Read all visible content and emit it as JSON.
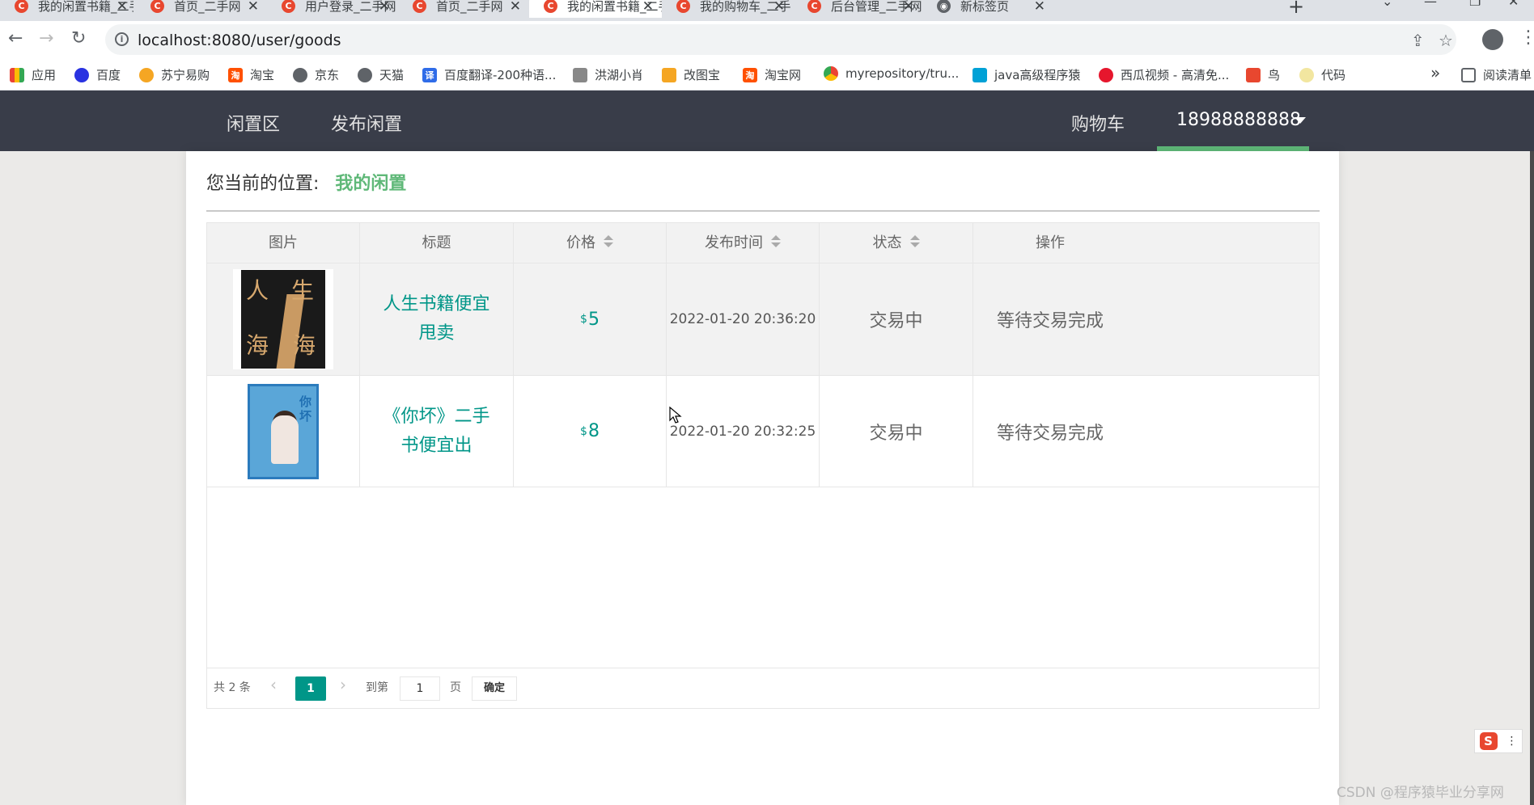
{
  "browser": {
    "tabs": [
      {
        "title": "我的闲置书籍_二手",
        "active": false
      },
      {
        "title": "首页_二手网",
        "active": false
      },
      {
        "title": "用户登录_二手网",
        "active": false
      },
      {
        "title": "首页_二手网",
        "active": false
      },
      {
        "title": "我的闲置书籍_二手",
        "active": true
      },
      {
        "title": "我的购物车_二手",
        "active": false
      },
      {
        "title": "后台管理_二手网",
        "active": false
      },
      {
        "title": "新标签页",
        "active": false
      }
    ],
    "url": "localhost:8080/user/goods",
    "bookmarks": [
      "应用",
      "百度",
      "苏宁易购",
      "淘宝",
      "京东",
      "天猫",
      "百度翻译-200种语...",
      "洪湖小肖",
      "改图宝",
      "淘宝网",
      "myrepository/tru...",
      "java高级程序猿",
      "西瓜视频 - 高清免...",
      "鸟",
      "代码"
    ],
    "reading_list": "阅读清单"
  },
  "nav": {
    "links": [
      "闲置区",
      "发布闲置"
    ],
    "cart": "购物车",
    "user": "18988888888"
  },
  "breadcrumb": {
    "prefix": "您当前的位置:",
    "current": "我的闲置"
  },
  "table": {
    "headers": [
      "图片",
      "标题",
      "价格",
      "发布时间",
      "状态",
      "操作"
    ],
    "rows": [
      {
        "cover": "人生海海",
        "title": "人生书籍便宜甩卖",
        "currency": "$",
        "price": "5",
        "time": "2022-01-20 20:36:20",
        "status": "交易中",
        "action": "等待交易完成"
      },
      {
        "cover": "你坏",
        "title": "《你坏》二手书便宜出",
        "currency": "$",
        "price": "8",
        "time": "2022-01-20 20:32:25",
        "status": "交易中",
        "action": "等待交易完成"
      }
    ]
  },
  "pager": {
    "total": "共 2 条",
    "current": "1",
    "goto": "到第",
    "input": "1",
    "page_unit": "页",
    "confirm": "确定"
  },
  "overlay": {
    "watermark": "CSDN @程序猿毕业分享网",
    "ime": "S"
  },
  "colors": {
    "navbar": "#393d49",
    "accent_green": "#5fb878",
    "teal": "#009688"
  }
}
